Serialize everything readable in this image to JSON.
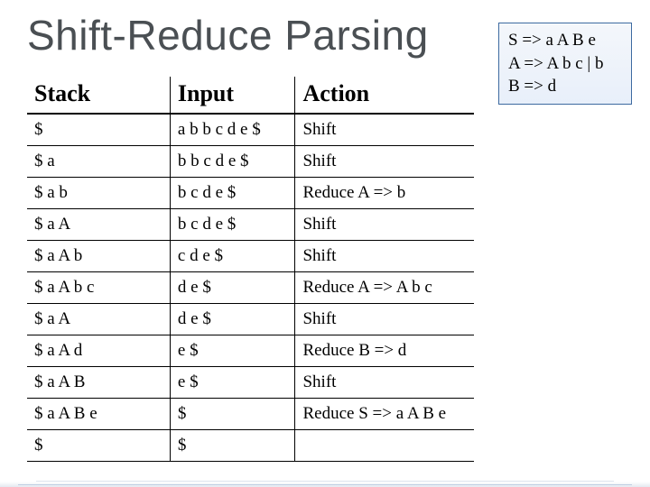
{
  "title": "Shift-Reduce Parsing",
  "grammar": {
    "lines": [
      "S => a A B e",
      "A => A b c | b",
      "B => d"
    ]
  },
  "table": {
    "headers": [
      "Stack",
      "Input",
      "Action"
    ],
    "rows": [
      {
        "stack": "$",
        "input": "a b b c d e $",
        "action": "Shift"
      },
      {
        "stack": "$ a",
        "input": "b b c d e $",
        "action": "Shift"
      },
      {
        "stack": "$ a b",
        "input": "b c d e $",
        "action": "Reduce A => b"
      },
      {
        "stack": "$ a A",
        "input": "b c d e $",
        "action": "Shift"
      },
      {
        "stack": "$ a A b",
        "input": "c d e $",
        "action": "Shift"
      },
      {
        "stack": "$ a A b c",
        "input": "d e $",
        "action": "Reduce A => A b c"
      },
      {
        "stack": "$ a A",
        "input": "d e $",
        "action": "Shift"
      },
      {
        "stack": "$ a A d",
        "input": "e $",
        "action": "Reduce B => d"
      },
      {
        "stack": "$ a A B",
        "input": "e $",
        "action": "Shift"
      },
      {
        "stack": "$ a A B e",
        "input": "$",
        "action": "Reduce S => a A B e"
      },
      {
        "stack": "$",
        "input": "$",
        "action": ""
      }
    ]
  },
  "chart_data": {
    "type": "table",
    "title": "Shift-Reduce Parsing trace",
    "columns": [
      "Stack",
      "Input",
      "Action"
    ],
    "rows": [
      [
        "$",
        "a b b c d e $",
        "Shift"
      ],
      [
        "$ a",
        "b b c d e $",
        "Shift"
      ],
      [
        "$ a b",
        "b c d e $",
        "Reduce A => b"
      ],
      [
        "$ a A",
        "b c d e $",
        "Shift"
      ],
      [
        "$ a A b",
        "c d e $",
        "Shift"
      ],
      [
        "$ a A b c",
        "d e $",
        "Reduce A => A b c"
      ],
      [
        "$ a A",
        "d e $",
        "Shift"
      ],
      [
        "$ a A d",
        "e $",
        "Reduce B => d"
      ],
      [
        "$ a A B",
        "e $",
        "Shift"
      ],
      [
        "$ a A B e",
        "$",
        "Reduce S => a A B e"
      ],
      [
        "$",
        "$",
        ""
      ]
    ]
  }
}
